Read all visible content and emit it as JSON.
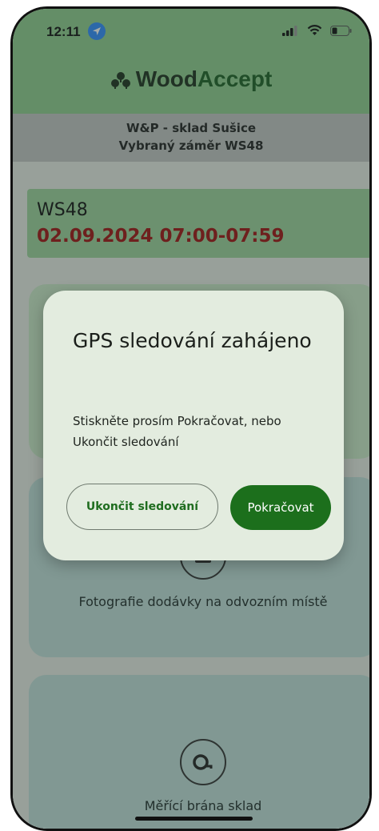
{
  "status_bar": {
    "time": "12:11"
  },
  "brand": {
    "part1": "Wood",
    "part2": "Accept",
    "logo_icon": "tree-cluster-icon"
  },
  "subheader": {
    "line1": "W&P - sklad Sušice",
    "line2": "Vybraný záměr WS48"
  },
  "plan": {
    "code": "WS48",
    "date_time": "02.09.2024 07:00-07:59"
  },
  "cards": {
    "photo_label": "Fotografie dodávky na odvozním místě",
    "gate_label": "Měřící brána sklad"
  },
  "dialog": {
    "title": "GPS sledování zahájeno",
    "message": "Stiskněte prosím Pokračovat, nebo Ukončit sledování",
    "stop_button": "Ukončit sledování",
    "continue_button": "Pokračovat"
  },
  "colors": {
    "header": "#8fce8e",
    "accent": "#1c6f1c",
    "date_red": "#a01010"
  }
}
